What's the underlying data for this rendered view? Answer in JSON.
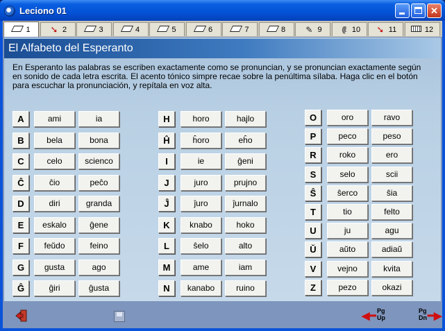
{
  "window": {
    "title": "Leciono 01"
  },
  "tabs": [
    {
      "label": "1",
      "icon": "book-icon",
      "active": true
    },
    {
      "label": "2",
      "icon": "arrow-icon"
    },
    {
      "label": "3",
      "icon": "book-icon"
    },
    {
      "label": "4",
      "icon": "book-icon"
    },
    {
      "label": "5",
      "icon": "book-icon"
    },
    {
      "label": "6",
      "icon": "book-icon"
    },
    {
      "label": "7",
      "icon": "book-icon"
    },
    {
      "label": "8",
      "icon": "book-icon"
    },
    {
      "label": "9",
      "icon": "pen-icon"
    },
    {
      "label": "10",
      "icon": "ear-icon"
    },
    {
      "label": "11",
      "icon": "arrow-icon"
    },
    {
      "label": "12",
      "icon": "keyboard-icon"
    }
  ],
  "heading": "El Alfabeto del Esperanto",
  "intro": "En Esperanto las palabras se escriben exactamente como se pronuncian, y se pronuncian exactamente según en sonido de cada letra escrita. El acento tónico simpre recae sobre la penúltima sílaba. Haga clic en el botón para escuchar la pronunciación, y repítala en voz alta.",
  "columns": [
    [
      {
        "letter": "A",
        "words": [
          "ami",
          "ia"
        ]
      },
      {
        "letter": "B",
        "words": [
          "bela",
          "bona"
        ]
      },
      {
        "letter": "C",
        "words": [
          "celo",
          "scienco"
        ]
      },
      {
        "letter": "Ĉ",
        "words": [
          "ĉio",
          "peĉo"
        ]
      },
      {
        "letter": "D",
        "words": [
          "diri",
          "granda"
        ]
      },
      {
        "letter": "E",
        "words": [
          "eskalo",
          "ĝene"
        ]
      },
      {
        "letter": "F",
        "words": [
          "feŭdo",
          "feino"
        ]
      },
      {
        "letter": "G",
        "words": [
          "gusta",
          "ago"
        ]
      },
      {
        "letter": "Ĝ",
        "words": [
          "ĝiri",
          "ĝusta"
        ]
      }
    ],
    [
      {
        "letter": "H",
        "words": [
          "horo",
          "hajlo"
        ]
      },
      {
        "letter": "Ĥ",
        "words": [
          "ĥoro",
          "eĥo"
        ]
      },
      {
        "letter": "I",
        "words": [
          "ie",
          "ĝeni"
        ]
      },
      {
        "letter": "J",
        "words": [
          "juro",
          "prujno"
        ]
      },
      {
        "letter": "Ĵ",
        "words": [
          "ĵuro",
          "ĵurnalo"
        ]
      },
      {
        "letter": "K",
        "words": [
          "knabo",
          "hoko"
        ]
      },
      {
        "letter": "L",
        "words": [
          "ŝelo",
          "alto"
        ]
      },
      {
        "letter": "M",
        "words": [
          "ame",
          "iam"
        ]
      },
      {
        "letter": "N",
        "words": [
          "kanabo",
          "ruino"
        ]
      }
    ],
    [
      {
        "letter": "O",
        "words": [
          "oro",
          "ravo"
        ]
      },
      {
        "letter": "P",
        "words": [
          "peco",
          "peso"
        ]
      },
      {
        "letter": "R",
        "words": [
          "roko",
          "ero"
        ]
      },
      {
        "letter": "S",
        "words": [
          "selo",
          "scii"
        ]
      },
      {
        "letter": "Ŝ",
        "words": [
          "ŝerco",
          "ŝia"
        ]
      },
      {
        "letter": "T",
        "words": [
          "tio",
          "felto"
        ]
      },
      {
        "letter": "U",
        "words": [
          "ju",
          "agu"
        ]
      },
      {
        "letter": "Ŭ",
        "words": [
          "aŭto",
          "adiaŭ"
        ]
      },
      {
        "letter": "V",
        "words": [
          "vejno",
          "kvita"
        ]
      },
      {
        "letter": "Z",
        "words": [
          "pezo",
          "okazi"
        ]
      }
    ]
  ],
  "nav": {
    "pgup_top": "Pg",
    "pgup_bottom": "Up",
    "pgdn_top": "Pg",
    "pgdn_bottom": "Dn"
  }
}
